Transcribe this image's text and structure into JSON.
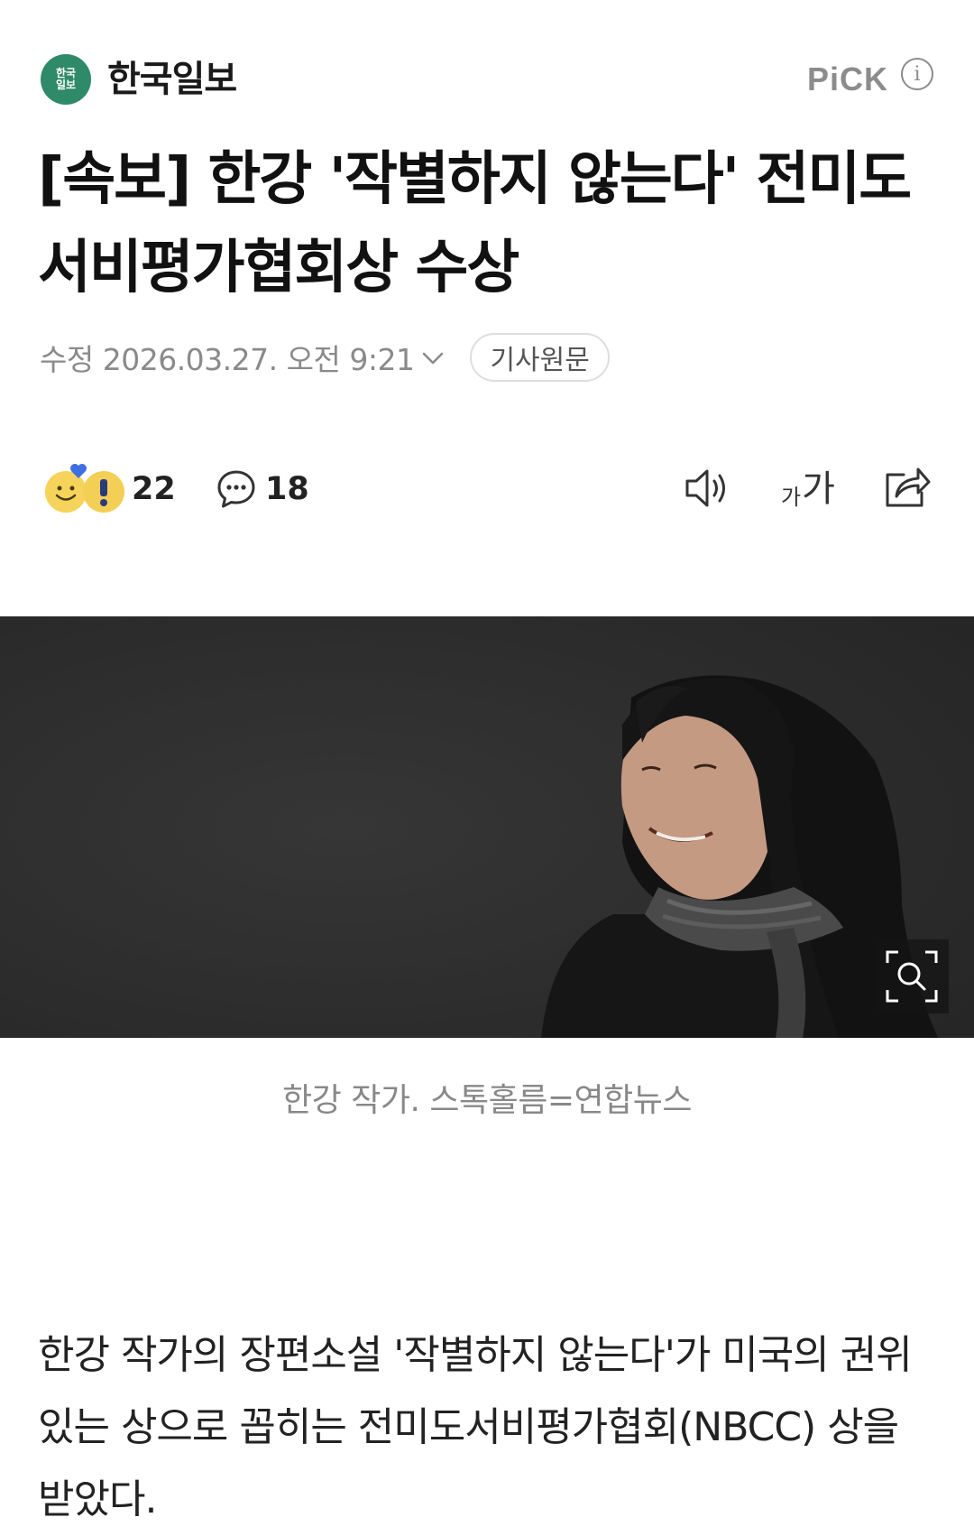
{
  "header": {
    "press_logo_text": "한국\n일보",
    "press_name": "한국일보",
    "pick_label": "PiCK",
    "info_icon": "info-icon"
  },
  "article": {
    "headline": "[속보] 한강 '작별하지 않는다' 전미도서비평가협회상 수상",
    "modified_date": "수정 2026.03.27. 오전 9:21",
    "original_button": "기사원문",
    "reaction_count": "22",
    "comment_count": "18",
    "font_size_label_small": "가",
    "font_size_label_large": "가",
    "photo_caption": "한강 작가. 스톡홀름=연합뉴스",
    "body": "한강 작가의 장편소설 '작별하지 않는다'가 미국의 권위 있는 상으로 꼽히는 전미도서비평가협회(NBCC) 상을 받았다."
  },
  "icons": {
    "reaction": "reaction-emoji-icon",
    "comment": "comment-icon",
    "tts": "speaker-icon",
    "font": "font-size-icon",
    "share": "share-icon",
    "zoom": "zoom-icon",
    "date_expand": "chevron-down-icon"
  },
  "colors": {
    "press_logo_bg": "#2f8a6a",
    "muted_text": "#8a8a8a",
    "photo_bg": "#2e2e2e"
  }
}
